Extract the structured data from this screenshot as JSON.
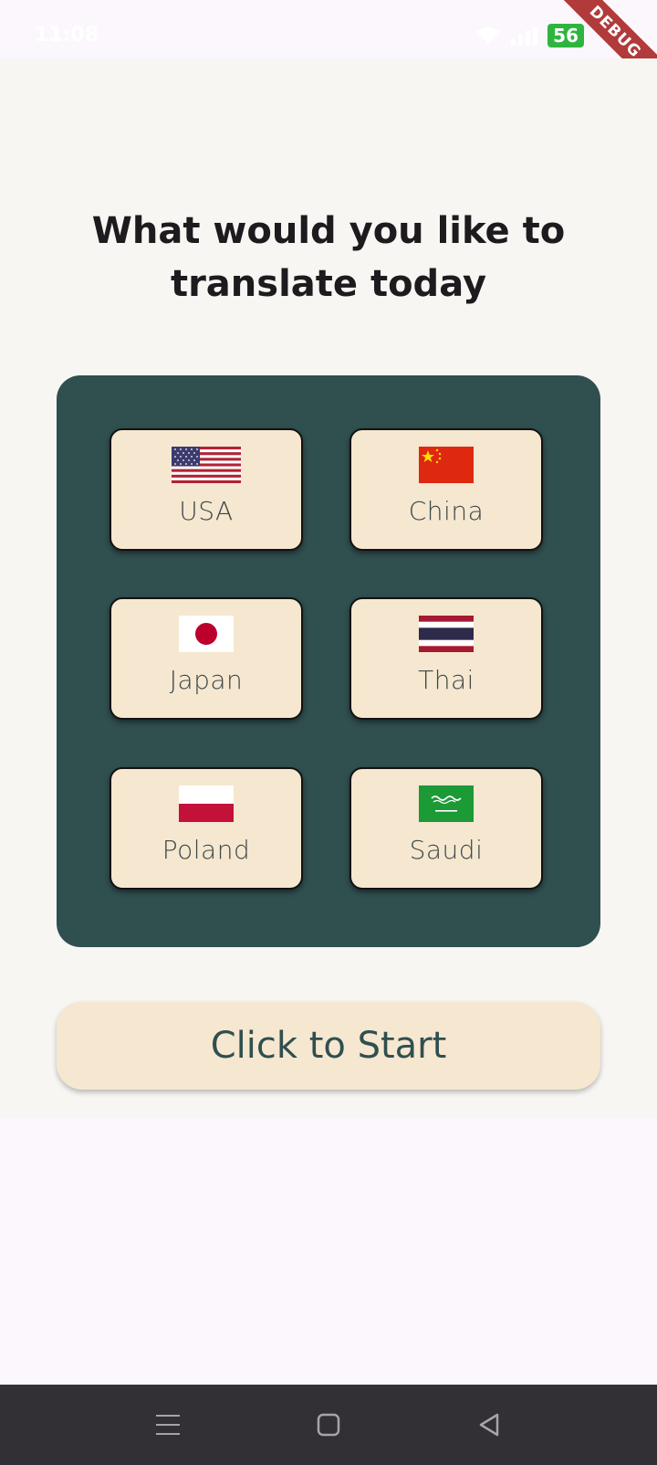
{
  "status_bar": {
    "time": "11:08",
    "battery": "56",
    "icons": [
      "wifi-icon",
      "signal-icon",
      "battery-icon"
    ]
  },
  "debug_banner": "DEBUG",
  "heading": {
    "line1": "What would you like to",
    "line2": "translate today"
  },
  "countries": [
    {
      "label": "USA",
      "flag": "usa-flag-icon"
    },
    {
      "label": "China",
      "flag": "china-flag-icon"
    },
    {
      "label": "Japan",
      "flag": "japan-flag-icon"
    },
    {
      "label": "Thai",
      "flag": "thailand-flag-icon"
    },
    {
      "label": "Poland",
      "flag": "poland-flag-icon"
    },
    {
      "label": "Saudi",
      "flag": "saudi-arabia-flag-icon"
    }
  ],
  "start_button": {
    "label": "Click to Start"
  },
  "nav_bar": {
    "buttons": [
      "menu-icon",
      "home-icon",
      "back-icon"
    ]
  },
  "colors": {
    "panel": "#304f4f",
    "card": "#f6e7d0",
    "background": "#f7f6f3",
    "heading": "#1e1a1e"
  }
}
